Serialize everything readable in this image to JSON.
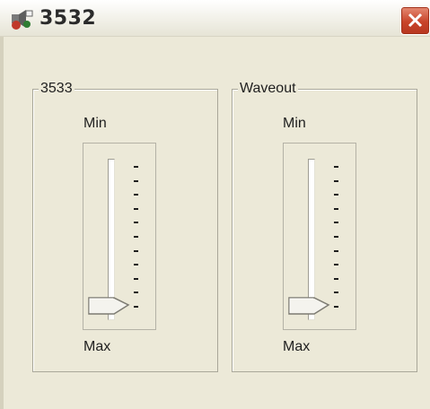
{
  "window": {
    "title": "3532",
    "icons": {
      "app": "speaker-app-icon",
      "close": "close-x-icon"
    }
  },
  "groups": [
    {
      "name": "3533",
      "min_label": "Min",
      "max_label": "Max",
      "value": 1.0
    },
    {
      "name": "Waveout",
      "min_label": "Min",
      "max_label": "Max",
      "value": 1.0
    }
  ],
  "colors": {
    "window_bg": "#ece9d8",
    "close_button": "#c8442a"
  }
}
